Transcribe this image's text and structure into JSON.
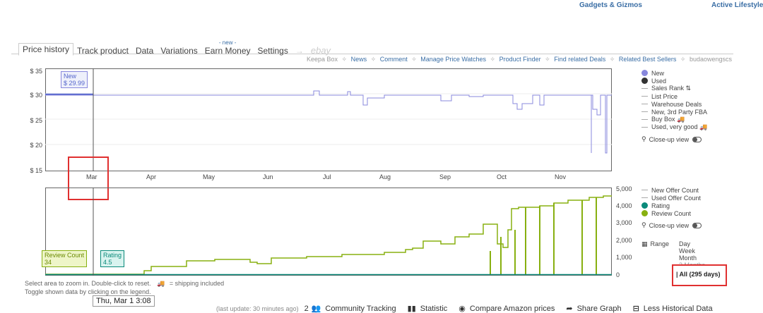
{
  "top_categories": [
    "Gadgets & Gizmos",
    "Active Lifestyle"
  ],
  "tabs": [
    {
      "label": "Price history",
      "active": true
    },
    {
      "label": "Track product"
    },
    {
      "label": "Data"
    },
    {
      "label": "Variations"
    },
    {
      "label": "Earn Money",
      "flag": "- new -"
    },
    {
      "label": "Settings"
    }
  ],
  "ebay_label": "ebay",
  "ebay_arrow": "→",
  "sub_links": {
    "keepa_box": "Keepa Box",
    "items": [
      "News",
      "Comment",
      "Manage Price Watches",
      "Product Finder",
      "Find related Deals",
      "Related Best Sellers",
      "budaowengscs"
    ],
    "separator": "✧"
  },
  "price_chart": {
    "y_ticks": [
      "$ 35",
      "$ 30",
      "$ 25",
      "$ 20",
      "$ 15"
    ],
    "x_ticks": [
      "Mar",
      "Apr",
      "May",
      "Jun",
      "Jul",
      "Aug",
      "Sep",
      "Oct",
      "Nov"
    ],
    "tooltip_label": "New",
    "tooltip_value": "$ 29.99",
    "line_color": "#8888dd"
  },
  "count_chart": {
    "y_ticks": [
      "5,000",
      "4,000",
      "3,000",
      "2,000",
      "1,000",
      "0"
    ],
    "review_tooltip_label": "Review Count",
    "review_tooltip_value": "34",
    "rating_tooltip_label": "Rating",
    "rating_tooltip_value": "4.5",
    "review_color": "#88b010",
    "rating_color": "#0a8a7a"
  },
  "price_legend": {
    "items": [
      {
        "label": "New",
        "kind": "dot",
        "color": "#8888dd"
      },
      {
        "label": "Used",
        "kind": "dot",
        "color": "#333333"
      },
      {
        "label": "Sales Rank ⇅",
        "kind": "dash"
      },
      {
        "label": "List Price",
        "kind": "dash"
      },
      {
        "label": "Warehouse Deals",
        "kind": "dash"
      },
      {
        "label": "New, 3rd Party FBA",
        "kind": "dash"
      },
      {
        "label": "Buy Box 🚚",
        "kind": "dash"
      },
      {
        "label": "Used, very good 🚚",
        "kind": "dash"
      }
    ],
    "closeup": "Close-up view"
  },
  "count_legend": {
    "items": [
      {
        "label": "New Offer Count",
        "kind": "dash"
      },
      {
        "label": "Used Offer Count",
        "kind": "dash"
      },
      {
        "label": "Rating",
        "kind": "dot",
        "color": "#0a8a7a"
      },
      {
        "label": "Review Count",
        "kind": "dot",
        "color": "#88b010"
      }
    ],
    "closeup": "Close-up view",
    "range_label": "Range",
    "range_options": [
      "Day",
      "Week",
      "Month",
      "3 Months"
    ],
    "range_selected": "All (295 days)"
  },
  "help_text": {
    "line1_a": "Select area to zoom in. Double-click to reset.",
    "line1_b": "= shipping included",
    "line2": "Toggle shown data by clicking on the legend."
  },
  "crosshair_date": "Thu, Mar 1 3:08",
  "bottom_bar": {
    "last_update": "(last update: 30 minutes ago)",
    "community_count": "2",
    "community": "Community Tracking",
    "statistic": "Statistic",
    "compare": "Compare Amazon prices",
    "share": "Share Graph",
    "less": "Less Historical Data"
  },
  "chart_data": [
    {
      "type": "line",
      "title": "",
      "xlabel": "",
      "ylabel": "",
      "ylim": [
        15,
        35
      ],
      "x_ticks": [
        "Mar",
        "Apr",
        "May",
        "Jun",
        "Jul",
        "Aug",
        "Sep",
        "Oct",
        "Nov"
      ],
      "series": [
        {
          "name": "New",
          "x": [
            "Mar 1",
            "Jul 1",
            "Jul 5",
            "Jul 18",
            "Jul 25",
            "Aug 1",
            "Sep 1",
            "Sep 25",
            "Oct 1",
            "Oct 20",
            "Oct 25",
            "Nov 20",
            "Nov 25",
            "Nov 28"
          ],
          "values": [
            29.99,
            29.99,
            31,
            29.99,
            28,
            29.99,
            29.99,
            28.5,
            29.99,
            28,
            29.99,
            27,
            19,
            29.99
          ]
        }
      ]
    },
    {
      "type": "line",
      "title": "",
      "ylim": [
        0,
        5000
      ],
      "series": [
        {
          "name": "Review Count",
          "x": [
            "Mar 1",
            "Apr 1",
            "May 1",
            "Jun 1",
            "Jul 1",
            "Aug 1",
            "Sep 1",
            "Oct 1",
            "Oct 15",
            "Nov 1",
            "Nov 28"
          ],
          "values": [
            34,
            150,
            700,
            800,
            900,
            1100,
            1400,
            1800,
            4000,
            4300,
            4600
          ]
        },
        {
          "name": "Rating",
          "x": [
            "Mar 1",
            "Nov 28"
          ],
          "values": [
            4.5,
            4.5
          ]
        }
      ]
    }
  ]
}
